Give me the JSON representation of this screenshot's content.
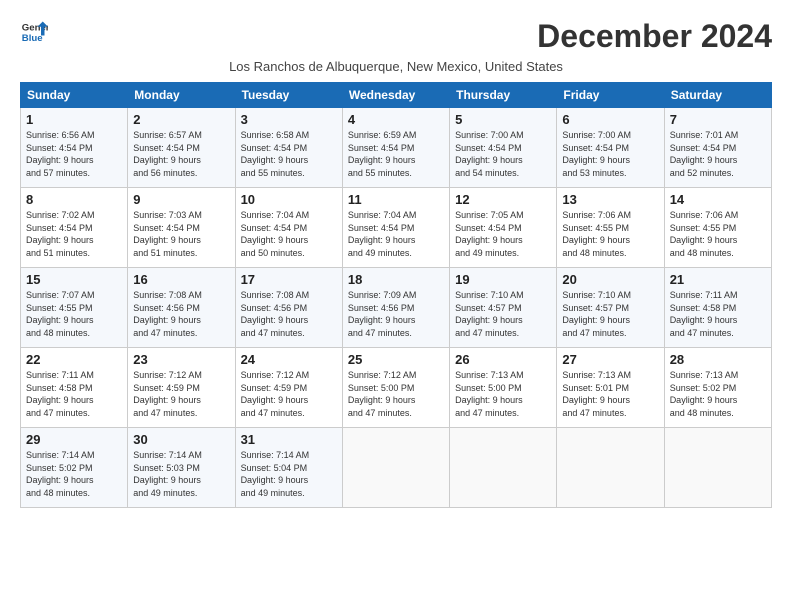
{
  "logo": {
    "line1": "General",
    "line2": "Blue"
  },
  "title": "December 2024",
  "subtitle": "Los Ranchos de Albuquerque, New Mexico, United States",
  "columns": [
    "Sunday",
    "Monday",
    "Tuesday",
    "Wednesday",
    "Thursday",
    "Friday",
    "Saturday"
  ],
  "weeks": [
    [
      {
        "day": "1",
        "lines": [
          "Sunrise: 6:56 AM",
          "Sunset: 4:54 PM",
          "Daylight: 9 hours",
          "and 57 minutes."
        ]
      },
      {
        "day": "2",
        "lines": [
          "Sunrise: 6:57 AM",
          "Sunset: 4:54 PM",
          "Daylight: 9 hours",
          "and 56 minutes."
        ]
      },
      {
        "day": "3",
        "lines": [
          "Sunrise: 6:58 AM",
          "Sunset: 4:54 PM",
          "Daylight: 9 hours",
          "and 55 minutes."
        ]
      },
      {
        "day": "4",
        "lines": [
          "Sunrise: 6:59 AM",
          "Sunset: 4:54 PM",
          "Daylight: 9 hours",
          "and 55 minutes."
        ]
      },
      {
        "day": "5",
        "lines": [
          "Sunrise: 7:00 AM",
          "Sunset: 4:54 PM",
          "Daylight: 9 hours",
          "and 54 minutes."
        ]
      },
      {
        "day": "6",
        "lines": [
          "Sunrise: 7:00 AM",
          "Sunset: 4:54 PM",
          "Daylight: 9 hours",
          "and 53 minutes."
        ]
      },
      {
        "day": "7",
        "lines": [
          "Sunrise: 7:01 AM",
          "Sunset: 4:54 PM",
          "Daylight: 9 hours",
          "and 52 minutes."
        ]
      }
    ],
    [
      {
        "day": "8",
        "lines": [
          "Sunrise: 7:02 AM",
          "Sunset: 4:54 PM",
          "Daylight: 9 hours",
          "and 51 minutes."
        ]
      },
      {
        "day": "9",
        "lines": [
          "Sunrise: 7:03 AM",
          "Sunset: 4:54 PM",
          "Daylight: 9 hours",
          "and 51 minutes."
        ]
      },
      {
        "day": "10",
        "lines": [
          "Sunrise: 7:04 AM",
          "Sunset: 4:54 PM",
          "Daylight: 9 hours",
          "and 50 minutes."
        ]
      },
      {
        "day": "11",
        "lines": [
          "Sunrise: 7:04 AM",
          "Sunset: 4:54 PM",
          "Daylight: 9 hours",
          "and 49 minutes."
        ]
      },
      {
        "day": "12",
        "lines": [
          "Sunrise: 7:05 AM",
          "Sunset: 4:54 PM",
          "Daylight: 9 hours",
          "and 49 minutes."
        ]
      },
      {
        "day": "13",
        "lines": [
          "Sunrise: 7:06 AM",
          "Sunset: 4:55 PM",
          "Daylight: 9 hours",
          "and 48 minutes."
        ]
      },
      {
        "day": "14",
        "lines": [
          "Sunrise: 7:06 AM",
          "Sunset: 4:55 PM",
          "Daylight: 9 hours",
          "and 48 minutes."
        ]
      }
    ],
    [
      {
        "day": "15",
        "lines": [
          "Sunrise: 7:07 AM",
          "Sunset: 4:55 PM",
          "Daylight: 9 hours",
          "and 48 minutes."
        ]
      },
      {
        "day": "16",
        "lines": [
          "Sunrise: 7:08 AM",
          "Sunset: 4:56 PM",
          "Daylight: 9 hours",
          "and 47 minutes."
        ]
      },
      {
        "day": "17",
        "lines": [
          "Sunrise: 7:08 AM",
          "Sunset: 4:56 PM",
          "Daylight: 9 hours",
          "and 47 minutes."
        ]
      },
      {
        "day": "18",
        "lines": [
          "Sunrise: 7:09 AM",
          "Sunset: 4:56 PM",
          "Daylight: 9 hours",
          "and 47 minutes."
        ]
      },
      {
        "day": "19",
        "lines": [
          "Sunrise: 7:10 AM",
          "Sunset: 4:57 PM",
          "Daylight: 9 hours",
          "and 47 minutes."
        ]
      },
      {
        "day": "20",
        "lines": [
          "Sunrise: 7:10 AM",
          "Sunset: 4:57 PM",
          "Daylight: 9 hours",
          "and 47 minutes."
        ]
      },
      {
        "day": "21",
        "lines": [
          "Sunrise: 7:11 AM",
          "Sunset: 4:58 PM",
          "Daylight: 9 hours",
          "and 47 minutes."
        ]
      }
    ],
    [
      {
        "day": "22",
        "lines": [
          "Sunrise: 7:11 AM",
          "Sunset: 4:58 PM",
          "Daylight: 9 hours",
          "and 47 minutes."
        ]
      },
      {
        "day": "23",
        "lines": [
          "Sunrise: 7:12 AM",
          "Sunset: 4:59 PM",
          "Daylight: 9 hours",
          "and 47 minutes."
        ]
      },
      {
        "day": "24",
        "lines": [
          "Sunrise: 7:12 AM",
          "Sunset: 4:59 PM",
          "Daylight: 9 hours",
          "and 47 minutes."
        ]
      },
      {
        "day": "25",
        "lines": [
          "Sunrise: 7:12 AM",
          "Sunset: 5:00 PM",
          "Daylight: 9 hours",
          "and 47 minutes."
        ]
      },
      {
        "day": "26",
        "lines": [
          "Sunrise: 7:13 AM",
          "Sunset: 5:00 PM",
          "Daylight: 9 hours",
          "and 47 minutes."
        ]
      },
      {
        "day": "27",
        "lines": [
          "Sunrise: 7:13 AM",
          "Sunset: 5:01 PM",
          "Daylight: 9 hours",
          "and 47 minutes."
        ]
      },
      {
        "day": "28",
        "lines": [
          "Sunrise: 7:13 AM",
          "Sunset: 5:02 PM",
          "Daylight: 9 hours",
          "and 48 minutes."
        ]
      }
    ],
    [
      {
        "day": "29",
        "lines": [
          "Sunrise: 7:14 AM",
          "Sunset: 5:02 PM",
          "Daylight: 9 hours",
          "and 48 minutes."
        ]
      },
      {
        "day": "30",
        "lines": [
          "Sunrise: 7:14 AM",
          "Sunset: 5:03 PM",
          "Daylight: 9 hours",
          "and 49 minutes."
        ]
      },
      {
        "day": "31",
        "lines": [
          "Sunrise: 7:14 AM",
          "Sunset: 5:04 PM",
          "Daylight: 9 hours",
          "and 49 minutes."
        ]
      },
      {
        "day": "",
        "lines": []
      },
      {
        "day": "",
        "lines": []
      },
      {
        "day": "",
        "lines": []
      },
      {
        "day": "",
        "lines": []
      }
    ]
  ]
}
